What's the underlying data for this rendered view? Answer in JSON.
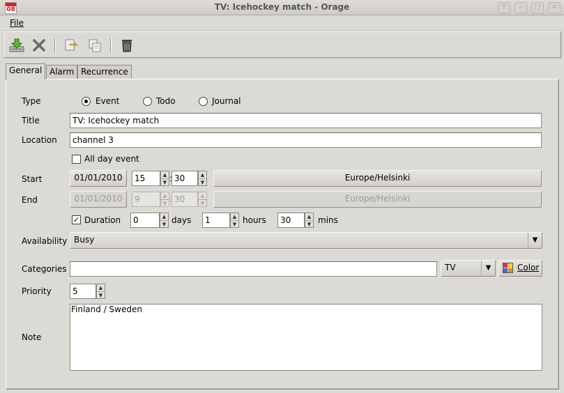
{
  "window": {
    "title": "TV: Icehockey match - Orage",
    "icon_number": "08",
    "controls": [
      "↑",
      "–",
      "□",
      "✕"
    ]
  },
  "menu": {
    "file": "File"
  },
  "toolbar": {
    "buttons": [
      "save-icon",
      "close-icon",
      "duplicate-icon",
      "copy-icon",
      "delete-icon"
    ]
  },
  "tabs": [
    "General",
    "Alarm",
    "Recurrence"
  ],
  "form": {
    "type_label": "Type",
    "type_options": [
      "Event",
      "Todo",
      "Journal"
    ],
    "title_label": "Title",
    "title_value": "TV: Icehockey match",
    "location_label": "Location",
    "location_value": "channel 3",
    "allday_label": "All day event",
    "allday_checked": false,
    "start_label": "Start",
    "start_date": "01/01/2010",
    "start_hour": "15",
    "start_min": "30",
    "start_tz": "Europe/Helsinki",
    "end_label": "End",
    "end_date": "01/01/2010",
    "end_hour": "9",
    "end_min": "30",
    "end_tz": "Europe/Helsinki",
    "time_sep": ":",
    "duration_label": "Duration",
    "duration_checked": true,
    "dur_days": "0",
    "dur_days_label": "days",
    "dur_hours": "1",
    "dur_hours_label": "hours",
    "dur_mins": "30",
    "dur_mins_label": "mins",
    "availability_label": "Availability",
    "availability_value": "Busy",
    "categories_label": "Categories",
    "categories_value": "",
    "category_select": "TV",
    "color_button": "Color",
    "priority_label": "Priority",
    "priority_value": "5",
    "note_label": "Note",
    "note_value": "Finland / Sweden"
  }
}
